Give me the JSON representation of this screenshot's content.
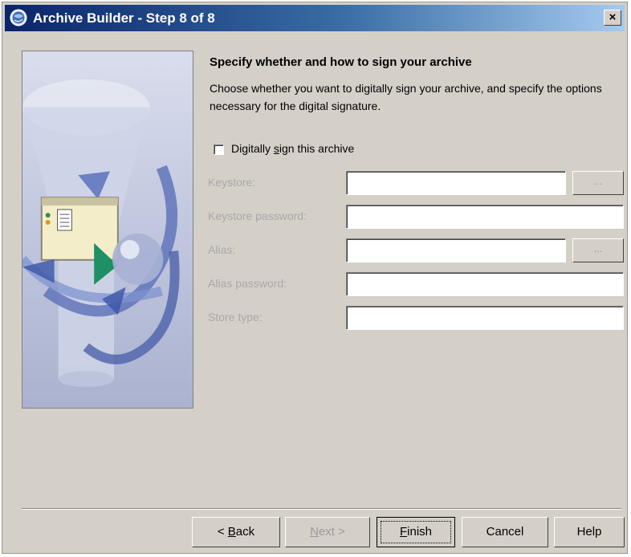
{
  "window": {
    "title": "Archive Builder - Step 8 of 8",
    "close_label": "×"
  },
  "main": {
    "heading": "Specify whether and how to sign your archive",
    "description": "Choose whether you want to digitally sign your archive, and specify the options necessary for the digital signature.",
    "sign_checkbox": {
      "label_pre": "Digitally ",
      "label_access": "s",
      "label_post": "ign this archive",
      "checked": false
    },
    "fields": [
      {
        "label": "Keystore:",
        "value": "",
        "has_browse": true
      },
      {
        "label": "Keystore password:",
        "value": "",
        "has_browse": false
      },
      {
        "label": "Alias:",
        "value": "",
        "has_browse": true
      },
      {
        "label": "Alias password:",
        "value": "",
        "has_browse": false
      },
      {
        "label": "Store type:",
        "value": "",
        "has_browse": false
      }
    ],
    "browse_label": "..."
  },
  "buttons": {
    "back": {
      "pre": "< ",
      "access": "B",
      "post": "ack"
    },
    "next": {
      "pre": "",
      "access": "N",
      "post": "ext >",
      "disabled": true
    },
    "finish": {
      "pre": "",
      "access": "F",
      "post": "inish",
      "default": true
    },
    "cancel": {
      "label": "Cancel"
    },
    "help": {
      "label": "Help"
    }
  },
  "colors": {
    "dialog_bg": "#d4d0c8",
    "titlebar_start": "#0a246a",
    "titlebar_end": "#a6caf0",
    "disabled_text": "#a8a8a8"
  },
  "icons": {
    "title_icon": "jdeveloper-globe-icon",
    "side_image": "archive-wizard-illustration"
  }
}
